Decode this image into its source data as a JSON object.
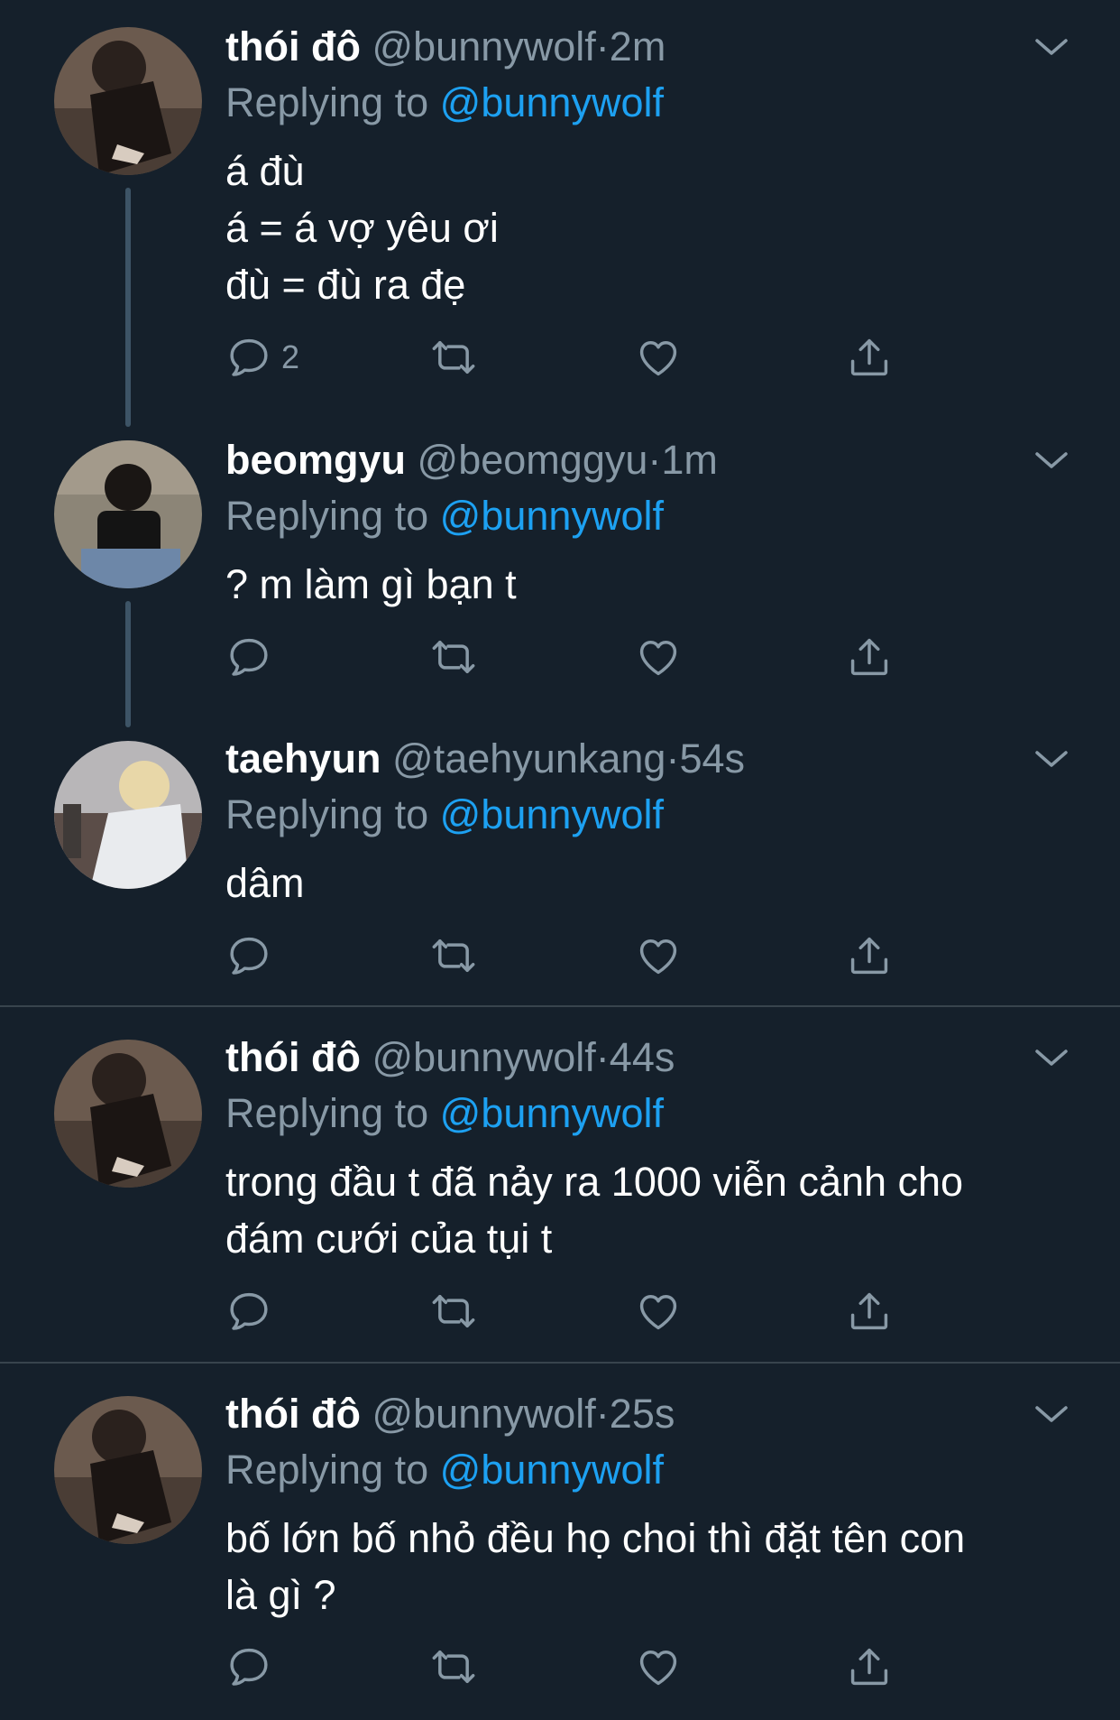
{
  "tweets": [
    {
      "name": "thói đô",
      "handle": "@bunnywolf",
      "dot": "·",
      "time": "2m",
      "replying_prefix": "Replying to",
      "replying_to": "@bunnywolf",
      "lines": [
        "á đù",
        "á = á vợ yêu ơi",
        "đù = đù ra đẹ"
      ],
      "reply_count": "2"
    },
    {
      "name": "beomgyu",
      "handle": "@beomggyu",
      "dot": "·",
      "time": "1m",
      "replying_prefix": "Replying to",
      "replying_to": "@bunnywolf",
      "lines": [
        "? m làm gì bạn t"
      ],
      "reply_count": ""
    },
    {
      "name": "taehyun",
      "handle": "@taehyunkang",
      "dot": "·",
      "time": "54s",
      "replying_prefix": "Replying to",
      "replying_to": "@bunnywolf",
      "lines": [
        "dâm"
      ],
      "reply_count": ""
    },
    {
      "name": "thói đô",
      "handle": "@bunnywolf",
      "dot": "·",
      "time": "44s",
      "replying_prefix": "Replying to",
      "replying_to": "@bunnywolf",
      "lines": [
        "trong đầu t đã nảy ra 1000 viễn cảnh cho",
        "đám cưới của tụi t"
      ],
      "reply_count": ""
    },
    {
      "name": "thói đô",
      "handle": "@bunnywolf",
      "dot": "·",
      "time": "25s",
      "replying_prefix": "Replying to",
      "replying_to": "@bunnywolf",
      "lines": [
        "bố lớn bố nhỏ đều họ choi thì đặt tên con",
        "là gì ?"
      ],
      "reply_count": ""
    }
  ],
  "icons": {
    "reply": "reply-icon",
    "retweet": "retweet-icon",
    "like": "like-icon",
    "share": "share-icon",
    "caret": "chevron-down-icon"
  },
  "colors": {
    "background": "#15202b",
    "muted": "#8899a6",
    "mention": "#1da1f2",
    "divider": "#38444d"
  }
}
